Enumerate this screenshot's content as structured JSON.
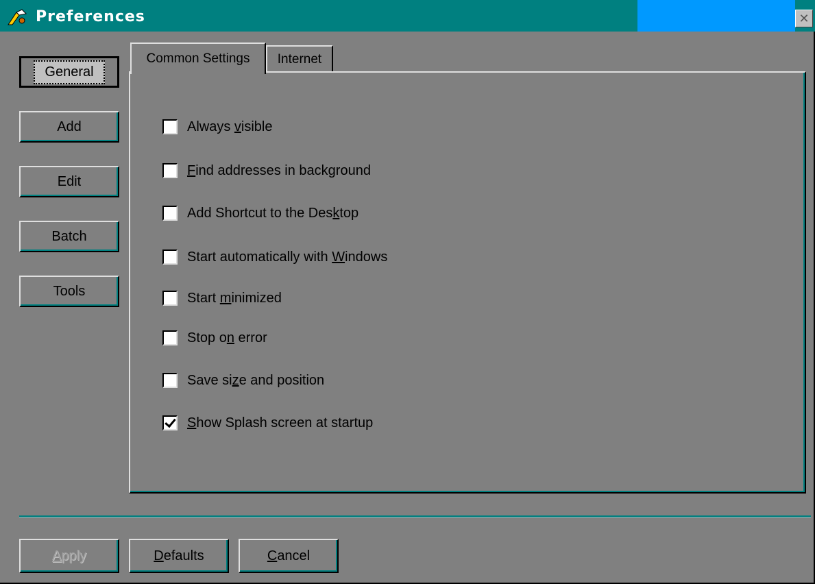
{
  "window": {
    "title": "Preferences",
    "app_icon": "wizard-icon",
    "close_icon": "close-icon"
  },
  "sidebar": {
    "items": [
      {
        "label": "General",
        "active": true
      },
      {
        "label": "Add",
        "active": false
      },
      {
        "label": "Edit",
        "active": false
      },
      {
        "label": "Batch",
        "active": false
      },
      {
        "label": "Tools",
        "active": false
      }
    ]
  },
  "tabs": [
    {
      "label": "Common Settings",
      "active": true
    },
    {
      "label": "Internet",
      "active": false
    }
  ],
  "options": [
    {
      "before": "Always ",
      "u": "v",
      "after": "isible",
      "checked": false
    },
    {
      "before": "",
      "u": "F",
      "after": "ind addresses in background",
      "checked": false
    },
    {
      "before": "Add Shortcut to the Des",
      "u": "k",
      "after": "top",
      "checked": false
    },
    {
      "before": "Start automatically with ",
      "u": "W",
      "after": "indows",
      "checked": false
    },
    {
      "before": "Start ",
      "u": "m",
      "after": "inimized",
      "checked": false
    },
    {
      "before": "Stop o",
      "u": "n",
      "after": " error",
      "checked": false
    },
    {
      "before": "Save si",
      "u": "z",
      "after": "e and position",
      "checked": false
    },
    {
      "before": "",
      "u": "S",
      "after": "how Splash screen at startup",
      "checked": true
    }
  ],
  "buttons": {
    "apply": {
      "before": "",
      "u": "A",
      "after": "pply",
      "disabled": true
    },
    "defaults": {
      "before": "",
      "u": "D",
      "after": "efaults",
      "disabled": false
    },
    "cancel": {
      "before": "",
      "u": "C",
      "after": "ancel",
      "disabled": false
    }
  },
  "colors": {
    "titlebar": "#008080",
    "titlebar_accent": "#0099ff",
    "background": "#808080"
  }
}
